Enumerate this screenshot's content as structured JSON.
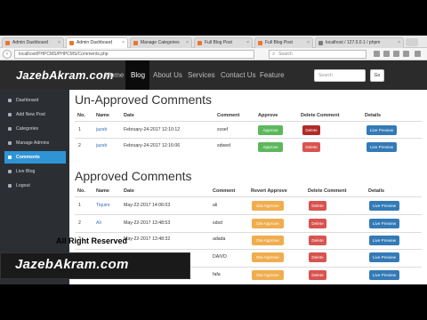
{
  "browser": {
    "tabs": [
      {
        "label": "Admin Dashboard",
        "active": false
      },
      {
        "label": "Admin Dashboard",
        "active": true
      },
      {
        "label": "Manage Categories",
        "active": false
      },
      {
        "label": "Full Blog Post",
        "active": false
      },
      {
        "label": "Full Blog Post",
        "active": false
      },
      {
        "label": "localhost / 127.0.0.1 / phpm",
        "active": false
      }
    ],
    "url": "localhost/PHPCMS/PHPCMS/Comments.php",
    "search_placeholder": "Search"
  },
  "site": {
    "logo": "JazebAkram.com",
    "nav": [
      "Home",
      "Blog",
      "About Us",
      "Services",
      "Contact Us",
      "Feature"
    ],
    "search_placeholder": "Search",
    "go_label": "Go"
  },
  "sidebar": {
    "items": [
      {
        "label": "Dashboard",
        "icon": "dashboard-icon",
        "active": false
      },
      {
        "label": "Add New Post",
        "icon": "list-icon",
        "active": false
      },
      {
        "label": "Categories",
        "icon": "tags-icon",
        "active": false
      },
      {
        "label": "Manage Admins",
        "icon": "user-icon",
        "active": false
      },
      {
        "label": "Comments",
        "icon": "comments-icon",
        "active": true
      },
      {
        "label": "Live Blog",
        "icon": "globe-icon",
        "active": false
      },
      {
        "label": "Logout",
        "icon": "logout-icon",
        "active": false
      }
    ]
  },
  "unapproved": {
    "title": "Un-Approved Comments",
    "headers": [
      "No.",
      "Name",
      "Date",
      "Comment",
      "Approve",
      "Delete Comment",
      "Details"
    ],
    "rows": [
      {
        "no": "1",
        "name": "jazeb",
        "date": "February-24-2017 12:10:12",
        "comment": "svsef",
        "approve": "Approve",
        "delete": "Delete",
        "details": "Live Preview"
      },
      {
        "no": "2",
        "name": "jazeb",
        "date": "February-24-2017 12:16:06",
        "comment": "sdwed",
        "approve": "Approve",
        "delete": "Delete",
        "details": "Live Preview"
      }
    ]
  },
  "approved": {
    "title": "Approved Comments",
    "headers": [
      "No.",
      "Name",
      "Date",
      "Comment",
      "Revert Approve",
      "Delete Comment",
      "Details"
    ],
    "rows": [
      {
        "no": "1",
        "name": "Tiquire",
        "date": "May-22-2017 14:06:03",
        "comment": "ali",
        "revert": "Dis-Approve",
        "delete": "Delete",
        "details": "Live Preview"
      },
      {
        "no": "2",
        "name": "Ali",
        "date": "May-22-2017 13:48:53",
        "comment": "sdsd",
        "revert": "Dis-Approve",
        "delete": "Delete",
        "details": "Live Preview"
      },
      {
        "no": "3",
        "name": "",
        "date": "May-22-2017 13:48:32",
        "comment": "adada",
        "revert": "Dis-Approve",
        "delete": "Delete",
        "details": "Live Preview"
      },
      {
        "no": "",
        "name": "",
        "date": "",
        "comment": "DAIVD",
        "revert": "Dis-Approve",
        "delete": "Delete",
        "details": "Live Preview"
      },
      {
        "no": "",
        "name": "",
        "date": "",
        "comment": "fafa",
        "revert": "Dis-Approve",
        "delete": "Delete",
        "details": "Live Preview"
      }
    ]
  },
  "overlay": {
    "rights": "All Right Reserved",
    "watermark": "JazebAkram.com"
  },
  "colors": {
    "approve": "#5cb85c",
    "delete": "#d9534f",
    "details": "#337ab7",
    "revert": "#f0ad4e",
    "sidebar_active": "#2f94d6"
  }
}
